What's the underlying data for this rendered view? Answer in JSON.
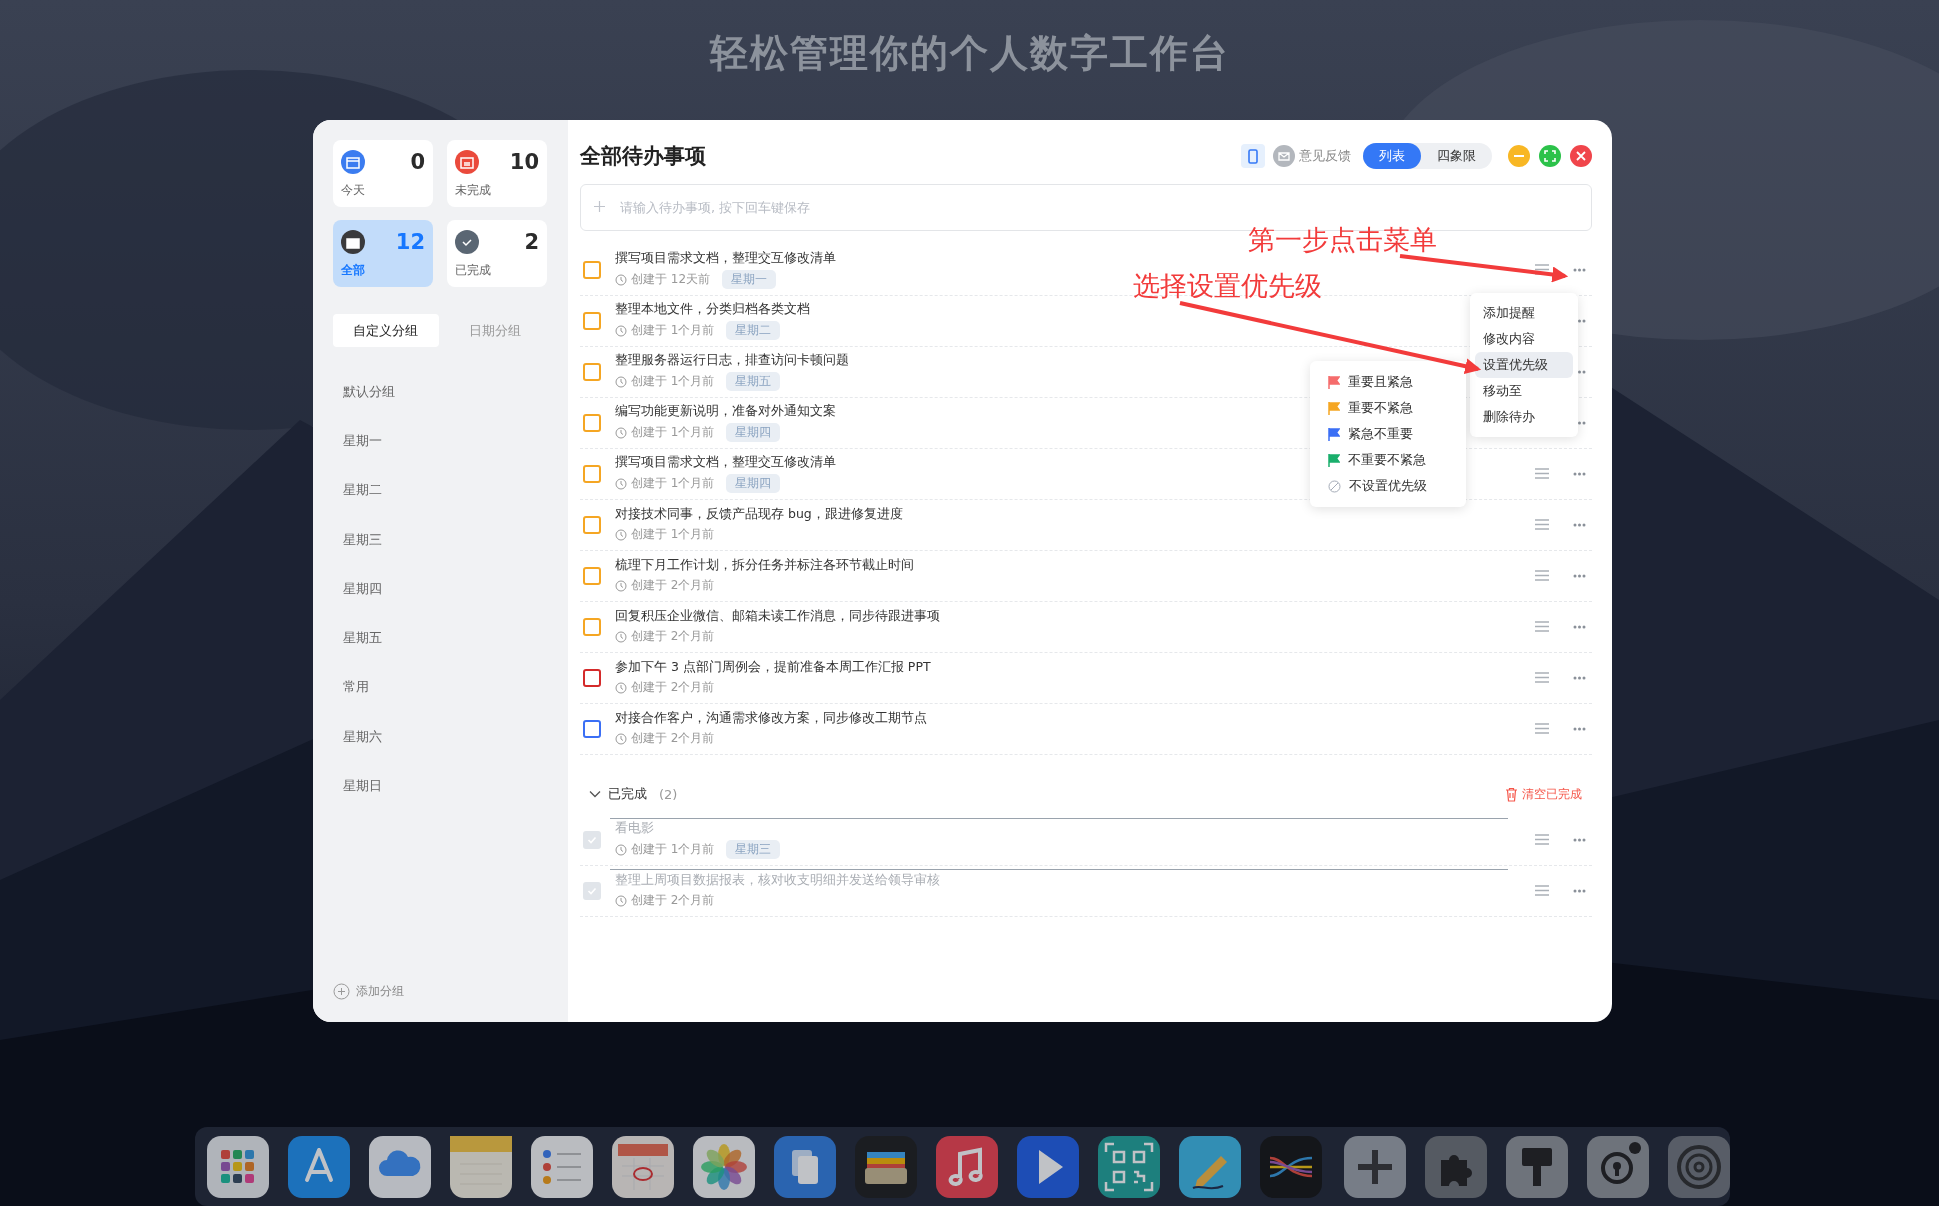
{
  "page_title": "轻松管理你的个人数字工作台",
  "sidebar": {
    "stats": [
      {
        "label": "今天",
        "count": "0",
        "color": "#3b7cf0",
        "selected": false
      },
      {
        "label": "未完成",
        "count": "10",
        "color": "#ea4a3c",
        "selected": false
      },
      {
        "label": "全部",
        "count": "12",
        "color": "#3a3a3c",
        "selected": true
      },
      {
        "label": "已完成",
        "count": "2",
        "color": "#5a6673",
        "selected": false
      }
    ],
    "group_tabs": [
      {
        "label": "自定义分组",
        "selected": true
      },
      {
        "label": "日期分组",
        "selected": false
      }
    ],
    "groups": [
      "默认分组",
      "星期一",
      "星期二",
      "星期三",
      "星期四",
      "星期五",
      "常用",
      "星期六",
      "星期日"
    ],
    "add_group": "添加分组"
  },
  "header": {
    "title": "全部待办事项",
    "feedback": "意见反馈",
    "view_tabs": [
      {
        "label": "列表",
        "selected": true
      },
      {
        "label": "四象限",
        "selected": false
      }
    ]
  },
  "input": {
    "placeholder": "请输入待办事项, 按下回车键保存"
  },
  "tasks": [
    {
      "title": "撰写项目需求文档，整理交互修改清单",
      "created": "创建于 12天前",
      "tag": "星期一",
      "color": "#f5a623",
      "checked": false
    },
    {
      "title": "整理本地文件，分类归档各类文档",
      "created": "创建于 1个月前",
      "tag": "星期二",
      "color": "#f5a623",
      "checked": false
    },
    {
      "title": "整理服务器运行日志，排查访问卡顿问题",
      "created": "创建于 1个月前",
      "tag": "星期五",
      "color": "#f5a623",
      "checked": false
    },
    {
      "title": "编写功能更新说明，准备对外通知文案",
      "created": "创建于 1个月前",
      "tag": "星期四",
      "color": "#f5a623",
      "checked": false
    },
    {
      "title": "撰写项目需求文档，整理交互修改清单",
      "created": "创建于 1个月前",
      "tag": "星期四",
      "color": "#f5a623",
      "checked": false
    },
    {
      "title": "对接技术同事，反馈产品现存 bug，跟进修复进度",
      "created": "创建于 1个月前",
      "color": "#f5a623",
      "checked": false
    },
    {
      "title": "梳理下月工作计划，拆分任务并标注各环节截止时间",
      "created": "创建于 2个月前",
      "color": "#f5a623",
      "checked": false
    },
    {
      "title": "回复积压企业微信、邮箱未读工作消息，同步待跟进事项",
      "created": "创建于 2个月前",
      "color": "#f5a623",
      "checked": false
    },
    {
      "title": "参加下午 3 点部门周例会，提前准备本周工作汇报 PPT",
      "created": "创建于 2个月前",
      "color": "#d42a2a",
      "checked": false
    },
    {
      "title": "对接合作客户，沟通需求修改方案，同步修改工期节点",
      "created": "创建于 2个月前",
      "color": "#3b6ff5",
      "checked": false
    }
  ],
  "completed": {
    "label": "已完成",
    "count": "(2)",
    "expanded": true,
    "clear": "清空已完成",
    "tasks": [
      {
        "title": "看电影",
        "created": "创建于 1个月前",
        "tag": "星期三",
        "checked": true
      },
      {
        "title": "整理上周项目数据报表，核对收支明细并发送给领导审核",
        "created": "创建于 2个月前",
        "checked": true
      }
    ]
  },
  "context_menu": {
    "items": [
      {
        "label": "添加提醒",
        "selected": false
      },
      {
        "label": "修改内容",
        "selected": false
      },
      {
        "label": "设置优先级",
        "selected": true
      },
      {
        "label": "移动至",
        "selected": false
      },
      {
        "label": "删除待办",
        "selected": false
      }
    ]
  },
  "priority_menu": {
    "items": [
      {
        "label": "重要且紧急",
        "kind": "flag",
        "color": "#f56c6c"
      },
      {
        "label": "重要不紧急",
        "kind": "flag",
        "color": "#f5a623"
      },
      {
        "label": "紧急不重要",
        "kind": "flag",
        "color": "#3b6ff5"
      },
      {
        "label": "不重要不紧急",
        "kind": "flag",
        "color": "#1aaf6c"
      },
      {
        "label": "不设置优先级",
        "kind": "none"
      }
    ]
  },
  "annotations": [
    {
      "text": "第一步点击菜单"
    },
    {
      "text": "选择设置优先级"
    }
  ]
}
